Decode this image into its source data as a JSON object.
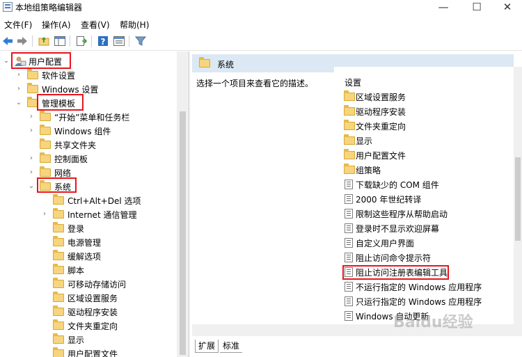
{
  "window": {
    "title": "本地组策略编辑器",
    "minimize": "—",
    "maximize": "☐",
    "close": "✕"
  },
  "menu": [
    "文件(F)",
    "操作(A)",
    "查看(V)",
    "帮助(H)"
  ],
  "tree": {
    "root": "用户配置",
    "items": [
      {
        "label": "软件设置"
      },
      {
        "label": "Windows 设置"
      },
      {
        "label": "管理模板"
      },
      {
        "label": "“开始”菜单和任务栏"
      },
      {
        "label": "Windows 组件"
      },
      {
        "label": "共享文件夹"
      },
      {
        "label": "控制面板"
      },
      {
        "label": "网络"
      },
      {
        "label": "系统"
      },
      {
        "label": "Ctrl+Alt+Del 选项"
      },
      {
        "label": "Internet 通信管理"
      },
      {
        "label": "登录"
      },
      {
        "label": "电源管理"
      },
      {
        "label": "缓解选项"
      },
      {
        "label": "脚本"
      },
      {
        "label": "可移动存储访问"
      },
      {
        "label": "区域设置服务"
      },
      {
        "label": "驱动程序安装"
      },
      {
        "label": "文件夹重定向"
      },
      {
        "label": "显示"
      },
      {
        "label": "用户配置文件"
      }
    ]
  },
  "right": {
    "header": "系统",
    "description": "选择一个项目来查看它的描述。",
    "list_header": "设置",
    "items": [
      {
        "label": "区域设置服务",
        "kind": "folder"
      },
      {
        "label": "驱动程序安装",
        "kind": "folder"
      },
      {
        "label": "文件夹重定向",
        "kind": "folder"
      },
      {
        "label": "显示",
        "kind": "folder"
      },
      {
        "label": "用户配置文件",
        "kind": "folder"
      },
      {
        "label": "组策略",
        "kind": "folder"
      },
      {
        "label": "下载缺少的 COM 组件",
        "kind": "policy"
      },
      {
        "label": "2000 年世纪转译",
        "kind": "policy"
      },
      {
        "label": "限制这些程序从帮助启动",
        "kind": "policy"
      },
      {
        "label": "登录时不显示欢迎屏幕",
        "kind": "policy"
      },
      {
        "label": "自定义用户界面",
        "kind": "policy"
      },
      {
        "label": "阻止访问命令提示符",
        "kind": "policy"
      },
      {
        "label": "阻止访问注册表编辑工具",
        "kind": "policy"
      },
      {
        "label": "不运行指定的 Windows 应用程序",
        "kind": "policy"
      },
      {
        "label": "只运行指定的 Windows 应用程序",
        "kind": "policy"
      },
      {
        "label": "Windows 自动更新",
        "kind": "policy"
      }
    ]
  },
  "tabs": [
    "扩展",
    "标准"
  ],
  "watermark": "Baidu经验",
  "colors": {
    "highlight": "#e8141d",
    "header_bg": "#dce8f3",
    "folder": "#f6d57e"
  }
}
